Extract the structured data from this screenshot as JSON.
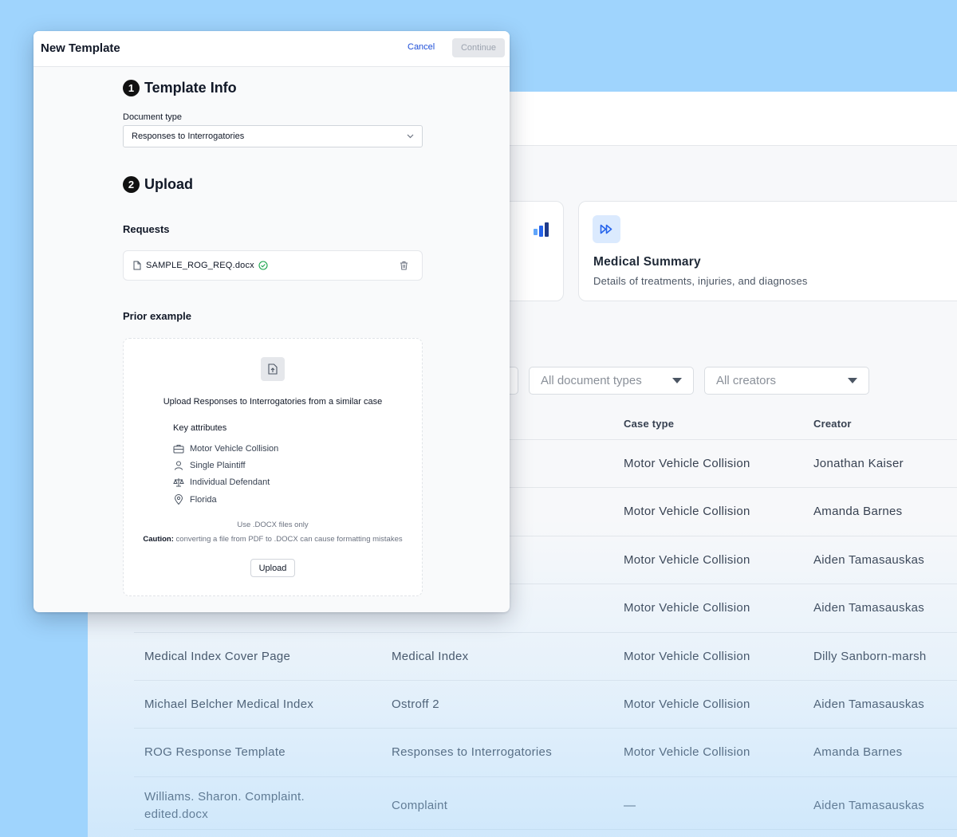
{
  "modal": {
    "title": "New Template",
    "cancel_label": "Cancel",
    "continue_label": "Continue",
    "step1": {
      "number": "1",
      "title": "Template Info"
    },
    "document_type_label": "Document type",
    "document_type_value": "Responses to Interrogatories",
    "step2": {
      "number": "2",
      "title": "Upload"
    },
    "requests_label": "Requests",
    "requests_file": "SAMPLE_ROG_REQ.docx",
    "prior_example_label": "Prior example",
    "dropzone": {
      "title": "Upload Responses to Interrogatories from a similar case",
      "attributes_title": "Key attributes",
      "attributes": [
        {
          "icon": "briefcase-icon",
          "label": "Motor Vehicle Collision"
        },
        {
          "icon": "person-icon",
          "label": "Single Plaintiff"
        },
        {
          "icon": "scale-icon",
          "label": "Individual Defendant"
        },
        {
          "icon": "location-pin-icon",
          "label": "Florida"
        }
      ],
      "note": "Use .DOCX files only",
      "caution_label": "Caution:",
      "caution_text": "converting a file from PDF to .DOCX can cause formatting mistakes",
      "upload_label": "Upload"
    }
  },
  "background": {
    "card": {
      "title": "Medical Summary",
      "description": "Details of treatments, injuries, and diagnoses",
      "icon": "fast-forward-icon"
    },
    "filters": {
      "document_types": "All document types",
      "creators": "All creators"
    },
    "table": {
      "headers": {
        "case_type": "Case type",
        "creator": "Creator"
      },
      "rows": [
        {
          "name": "",
          "type": "",
          "case": "Motor Vehicle Collision",
          "creator": "Jonathan Kaiser"
        },
        {
          "name": "",
          "type": "",
          "case": "Motor Vehicle Collision",
          "creator": "Amanda Barnes"
        },
        {
          "name": "",
          "type": "",
          "case": "Motor Vehicle Collision",
          "creator": "Aiden Tamasauskas"
        },
        {
          "name": "",
          "type": "",
          "case": "Motor Vehicle Collision",
          "creator": "Aiden Tamasauskas"
        },
        {
          "name": "Medical Index Cover Page",
          "type": "Medical Index",
          "case": "Motor Vehicle Collision",
          "creator": "Dilly Sanborn-marsh"
        },
        {
          "name": "Michael Belcher Medical Index",
          "type": "Ostroff 2",
          "case": "Motor Vehicle Collision",
          "creator": "Aiden Tamasauskas"
        },
        {
          "name": "ROG Response Template",
          "type": "Responses to Interrogatories",
          "case": "Motor Vehicle Collision",
          "creator": "Amanda Barnes"
        },
        {
          "name": "Williams. Sharon. Complaint. edited.docx",
          "type": "Complaint",
          "case": "—",
          "creator": "Aiden Tamasauskas"
        }
      ]
    }
  }
}
